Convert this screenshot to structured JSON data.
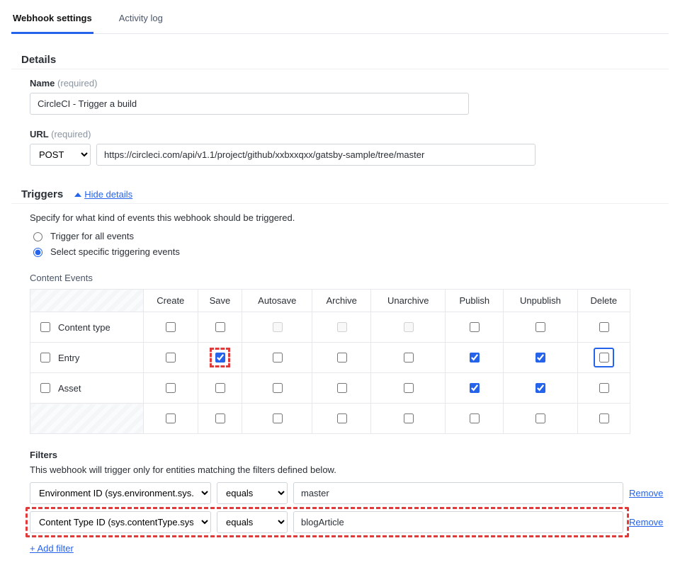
{
  "tabs": {
    "webhook_settings": "Webhook settings",
    "activity_log": "Activity log"
  },
  "sections": {
    "details": "Details",
    "triggers": "Triggers"
  },
  "details": {
    "name_label": "Name",
    "req": "(required)",
    "name_value": "CircleCI - Trigger a build",
    "url_label": "URL",
    "method": "POST",
    "url_value": "https://circleci.com/api/v1.1/project/github/xxbxxqxx/gatsby-sample/tree/master"
  },
  "triggers": {
    "hide_details": "Hide details",
    "desc": "Specify for what kind of events this webhook should be triggered.",
    "radio_all": "Trigger for all events",
    "radio_specific": "Select specific triggering events",
    "content_events": "Content Events",
    "cols": [
      "Create",
      "Save",
      "Autosave",
      "Archive",
      "Unarchive",
      "Publish",
      "Unpublish",
      "Delete"
    ],
    "rows": [
      {
        "name": "Content type",
        "cells": [
          "u",
          "u",
          "d",
          "d",
          "d",
          "u",
          "u",
          "u"
        ]
      },
      {
        "name": "Entry",
        "cells": [
          "u",
          "c_hl",
          "u",
          "u",
          "u",
          "c",
          "c",
          "u_blue"
        ]
      },
      {
        "name": "Asset",
        "cells": [
          "u",
          "u",
          "u",
          "u",
          "u",
          "c",
          "c",
          "u"
        ]
      },
      {
        "name": "",
        "cells": [
          "u",
          "u",
          "u",
          "u",
          "u",
          "u",
          "u",
          "u"
        ],
        "footer": true
      }
    ]
  },
  "filters": {
    "title": "Filters",
    "desc": "This webhook will trigger only for entities matching the filters defined below.",
    "rows": [
      {
        "field": "Environment ID (sys.environment.sys.id)",
        "op": "equals",
        "val": "master",
        "dashed": false
      },
      {
        "field": "Content Type ID (sys.contentType.sys.id)",
        "op": "equals",
        "val": "blogArticle",
        "dashed": true
      }
    ],
    "remove": "Remove",
    "add": "+ Add filter"
  }
}
